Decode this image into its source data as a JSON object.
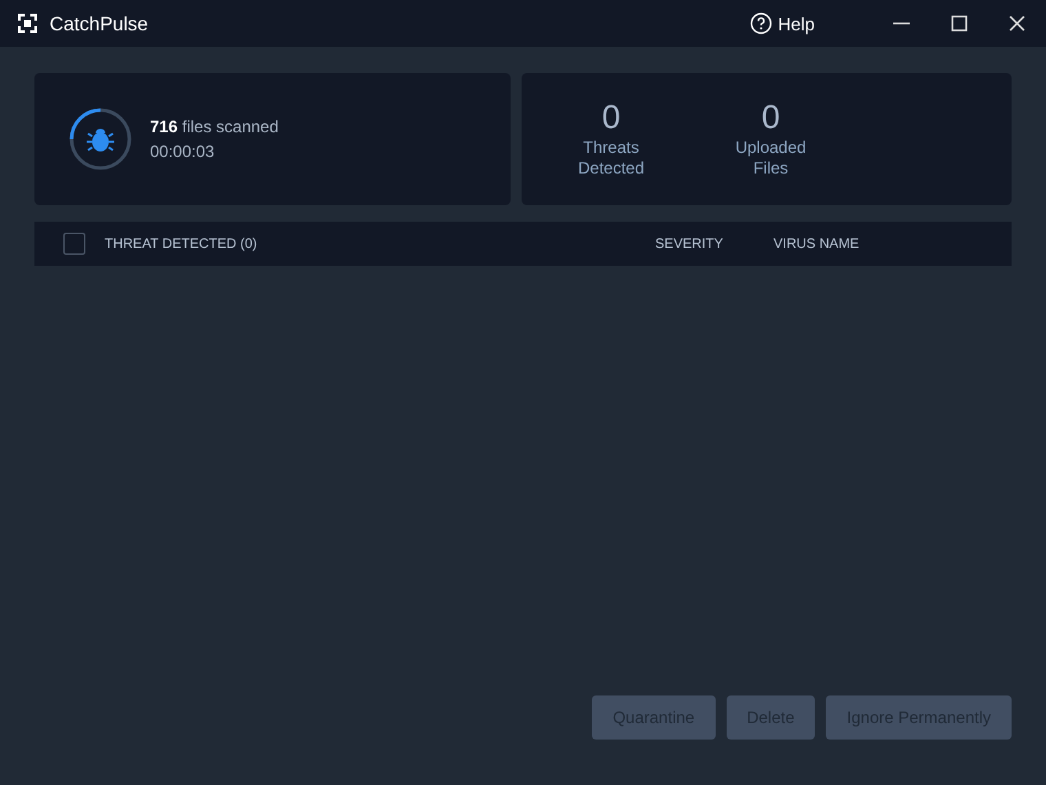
{
  "window": {
    "title": "CatchPulse",
    "help": "Help"
  },
  "scan": {
    "count": "716",
    "label": "files scanned",
    "elapsed": "00:00:03",
    "level": 0.25
  },
  "stats": [
    {
      "value": "0",
      "label": "Threats Detected"
    },
    {
      "value": "0",
      "label": "Uploaded Files"
    }
  ],
  "table": {
    "select_all": {
      "checked": false
    },
    "columns": [
      "THREAT DETECTED (0)",
      "SEVERITY",
      "VIRUS NAME"
    ]
  },
  "buttons": [
    {
      "label": "Quarantine",
      "disabled": true
    },
    {
      "label": "Delete",
      "disabled": true
    },
    {
      "label": "Ignore Permanently",
      "disabled": true
    }
  ]
}
